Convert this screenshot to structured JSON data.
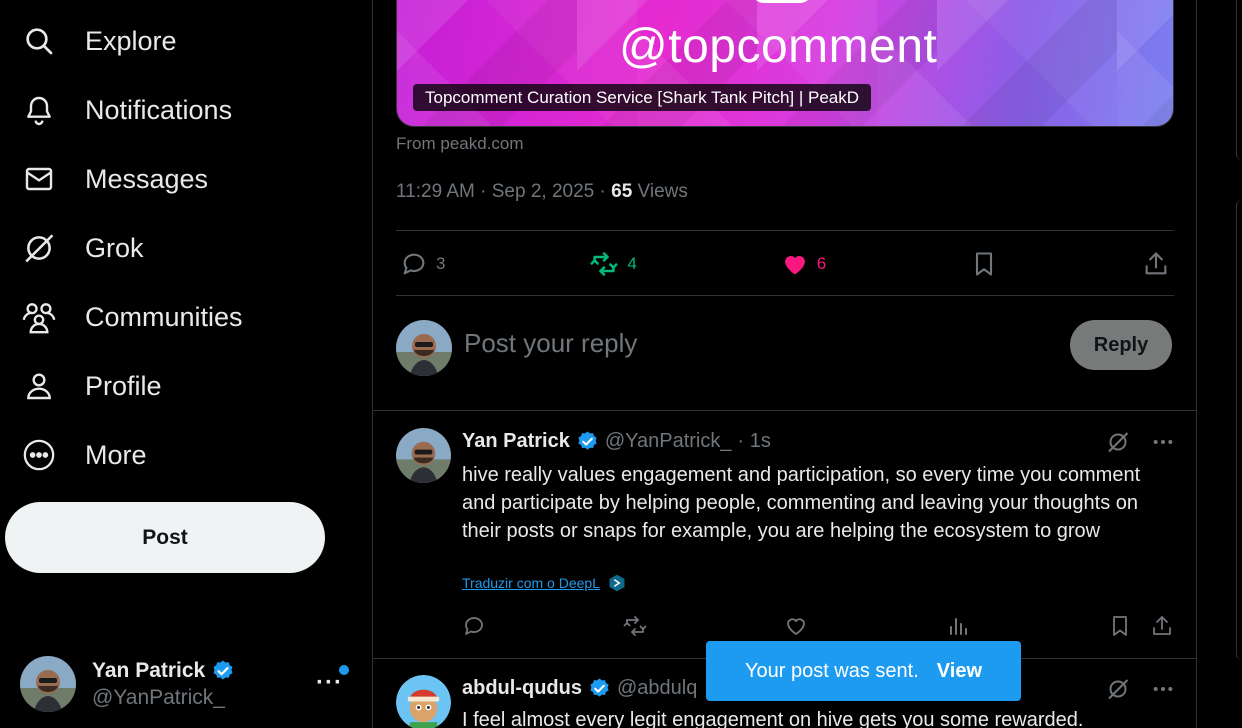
{
  "sidebar": {
    "items": [
      {
        "label": "Explore",
        "icon": "search-icon"
      },
      {
        "label": "Notifications",
        "icon": "bell-icon"
      },
      {
        "label": "Messages",
        "icon": "envelope-icon"
      },
      {
        "label": "Grok",
        "icon": "grok-icon"
      },
      {
        "label": "Communities",
        "icon": "communities-icon"
      },
      {
        "label": "Profile",
        "icon": "person-icon"
      },
      {
        "label": "More",
        "icon": "more-circle-icon"
      }
    ],
    "post_label": "Post",
    "account": {
      "name": "Yan Patrick",
      "handle": "@YanPatrick_"
    }
  },
  "post": {
    "card": {
      "image_text": "@topcomment",
      "caption": "Topcomment Curation Service [Shark Tank Pitch] | PeakD",
      "source": "From peakd.com"
    },
    "time": "11:29 AM · Sep 2, 2025 · ",
    "views_count": "65",
    "views_label": " Views",
    "stats": {
      "replies": "3",
      "reposts": "4",
      "likes": "6"
    }
  },
  "reply_box": {
    "placeholder": "Post your reply",
    "button": "Reply"
  },
  "replies": [
    {
      "name": "Yan Patrick",
      "handle": "@YanPatrick_",
      "time": "· 1s",
      "text": "hive really values engagement and participation, so every time you comment and participate by helping people, commenting and leaving your thoughts on their posts or snaps for example, you are helping the ecosystem to grow",
      "translate": "Traduzir com o DeepL"
    },
    {
      "name": "abdul-qudus",
      "handle": "@abdulq",
      "text": "I feel almost every legit engagement on hive gets you some rewarded."
    }
  ],
  "toast": {
    "message": "Your post was sent.",
    "action": "View"
  },
  "colors": {
    "accent": "#1d9bf0",
    "repost": "#00ba7c",
    "like": "#f91880",
    "background": "#000000"
  }
}
